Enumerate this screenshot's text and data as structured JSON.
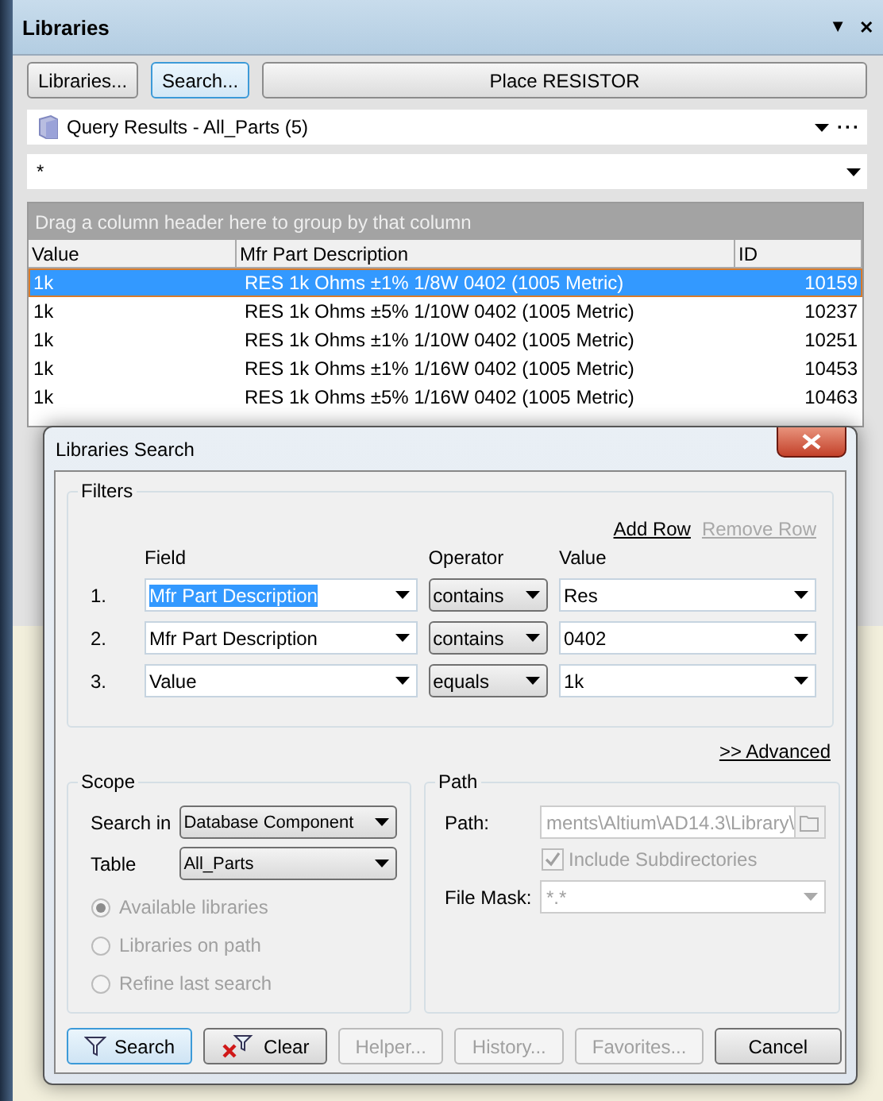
{
  "panel": {
    "title": "Libraries",
    "menu_glyph": "▼",
    "close_glyph": "✕",
    "buttons": [
      {
        "label": "Libraries...",
        "focused": false
      },
      {
        "label": "Search...",
        "focused": true
      },
      {
        "label": "Place RESISTOR",
        "focused": false
      }
    ],
    "library_select": {
      "value": "Query Results - All_Parts (5)",
      "more": "···"
    },
    "mask_field": {
      "value": "*"
    },
    "group_hint": "Drag a column header here to group by that column",
    "table": {
      "columns": [
        "Value",
        "Mfr Part Description",
        "ID"
      ],
      "rows": [
        {
          "value": "1k",
          "description": "RES 1k Ohms ±1% 1/8W 0402 (1005 Metric)",
          "id": "10159",
          "selected": true
        },
        {
          "value": "1k",
          "description": "RES 1k Ohms ±5% 1/10W 0402 (1005 Metric)",
          "id": "10237",
          "selected": false
        },
        {
          "value": "1k",
          "description": "RES 1k Ohms ±1% 1/10W 0402 (1005 Metric)",
          "id": "10251",
          "selected": false
        },
        {
          "value": "1k",
          "description": "RES 1k Ohms ±1% 1/16W 0402 (1005 Metric)",
          "id": "10453",
          "selected": false
        },
        {
          "value": "1k",
          "description": "RES 1k Ohms ±5% 1/16W 0402 (1005 Metric)",
          "id": "10463",
          "selected": false
        }
      ]
    }
  },
  "dialog": {
    "title": "Libraries Search",
    "filters": {
      "title": "Filters",
      "add_row": {
        "label": "Add Row",
        "disabled": false
      },
      "remove_row": {
        "label": "Remove Row",
        "disabled": true
      },
      "headers": [
        "Field",
        "Operator",
        "Value"
      ],
      "rows": [
        {
          "number": "1.",
          "field": "Mfr Part Description",
          "field_selected": true,
          "operator": "contains",
          "value": "Res"
        },
        {
          "number": "2.",
          "field": "Mfr Part Description",
          "field_selected": false,
          "operator": "contains",
          "value": "0402"
        },
        {
          "number": "3.",
          "field": "Value",
          "field_selected": false,
          "operator": "equals",
          "value": "1k"
        }
      ]
    },
    "advanced": ">> Advanced",
    "scope": {
      "title": "Scope",
      "search_in_label": "Search in",
      "search_in": "Database Component",
      "table_label": "Table",
      "table": "All_Parts",
      "options": [
        {
          "label": "Available libraries",
          "selected": true,
          "disabled": true
        },
        {
          "label": "Libraries on path",
          "selected": false,
          "disabled": true
        },
        {
          "label": "Refine last search",
          "selected": false,
          "disabled": true
        }
      ]
    },
    "path": {
      "title": "Path",
      "path_label": "Path:",
      "path_value": "ments\\Altium\\AD14.3\\Library\\",
      "include_subdirectories": {
        "label": "Include Subdirectories",
        "checked": true,
        "disabled": true
      },
      "file_mask_label": "File Mask:",
      "file_mask": "*.*"
    },
    "buttons": [
      {
        "label": "Search",
        "kind": "search",
        "disabled": false,
        "focused": true
      },
      {
        "label": "Clear",
        "kind": "clear",
        "disabled": false,
        "focused": false
      },
      {
        "label": "Helper...",
        "kind": "plain",
        "disabled": true,
        "focused": false
      },
      {
        "label": "History...",
        "kind": "plain",
        "disabled": true,
        "focused": false
      },
      {
        "label": "Favorites...",
        "kind": "plain",
        "disabled": true,
        "focused": false
      },
      {
        "label": "Cancel",
        "kind": "cancel",
        "disabled": false,
        "focused": false
      }
    ]
  }
}
